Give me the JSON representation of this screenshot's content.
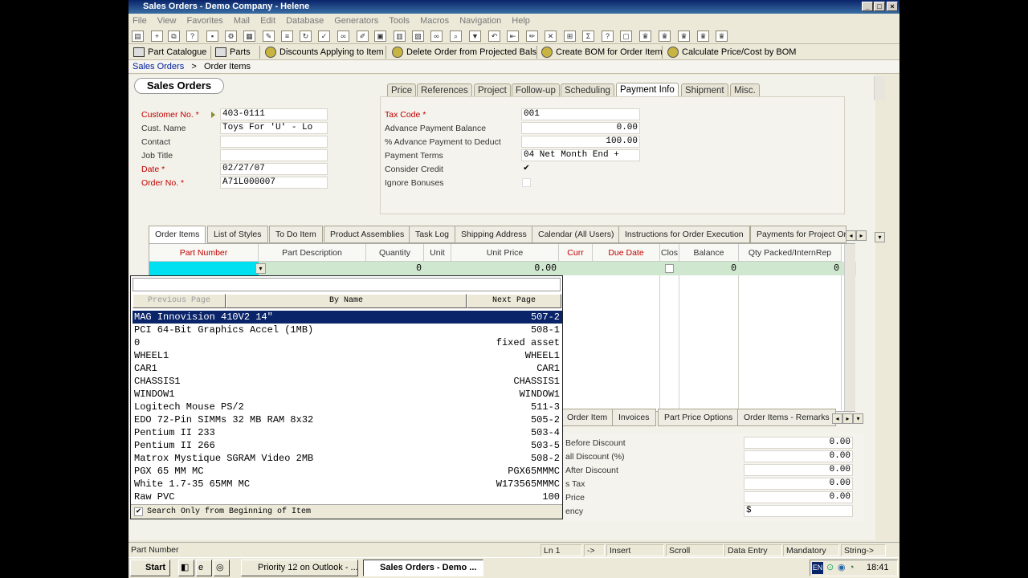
{
  "window": {
    "title": "Sales Orders - Demo Company - Helene"
  },
  "menu": [
    "File",
    "View",
    "Favorites",
    "Mail",
    "Edit",
    "Database",
    "Generators",
    "Tools",
    "Macros",
    "Navigation",
    "Help"
  ],
  "toolbar2": {
    "part_catalogue": "Part Catalogue",
    "parts": "Parts",
    "discounts": "Discounts Applying to Item",
    "delete_order": "Delete Order from Projected Bals",
    "create_bom": "Create BOM for Order Item",
    "calc_price": "Calculate Price/Cost by BOM"
  },
  "breadcrumb": {
    "root": "Sales Orders",
    "sep": ">",
    "current": "Order Items"
  },
  "form": {
    "title": "Sales Orders",
    "customer_no_label": "Customer No. *",
    "customer_no": "403-0111",
    "cust_name_label": "Cust. Name",
    "cust_name": "Toys For 'U' - Lo",
    "contact_label": "Contact",
    "contact": "",
    "job_title_label": "Job Title",
    "job_title": "",
    "date_label": "Date *",
    "date": "02/27/07",
    "order_no_label": "Order No. *",
    "order_no": "A71L000007"
  },
  "top_tabs": [
    "Price",
    "References",
    "Project",
    "Follow-up",
    "Scheduling",
    "Payment Info",
    "Shipment",
    "Misc."
  ],
  "payment": {
    "tax_code_label": "Tax Code *",
    "tax_code": "001",
    "adv_balance_label": "Advance Payment Balance",
    "adv_balance": "0.00",
    "adv_pct_label": "% Advance Payment to Deduct",
    "adv_pct": "100.00",
    "terms_label": "Payment Terms",
    "terms": "04  Net Month End +",
    "consider_credit_label": "Consider Credit",
    "ignore_bonuses_label": "Ignore Bonuses"
  },
  "grid_tabs": [
    "Order Items",
    "List of Styles",
    "To Do Item",
    "Product Assemblies",
    "Task Log",
    "Shipping Address",
    "Calendar (All Users)",
    "Instructions for Order Execution",
    "Payments for Project Or"
  ],
  "grid": {
    "headers": [
      "Part Number",
      "Part Description",
      "Quantity",
      "Unit",
      "Unit Price",
      "Curr",
      "Due Date",
      "Clos",
      "Balance",
      "Qty Packed/InternRep"
    ],
    "row": {
      "quantity": "0",
      "unit_price": "0.00",
      "balance": "0",
      "qty_packed": "0"
    }
  },
  "bottom_tabs": [
    "Order Item",
    "Invoices",
    "Part Price Options",
    "Order Items - Remarks"
  ],
  "totals": {
    "labels": [
      "Before Discount",
      "all Discount (%)",
      "After Discount",
      "s Tax",
      "Price",
      "ency"
    ],
    "values": [
      "0.00",
      "0.00",
      "0.00",
      "0.00",
      "0.00",
      "$"
    ]
  },
  "popup": {
    "prev": "Previous Page",
    "by_name": "By Name",
    "next": "Next Page",
    "items": [
      {
        "name": "MAG Innovision 410V2 14\"",
        "code": "507-2"
      },
      {
        "name": "PCI 64-Bit Graphics Accel (1MB)",
        "code": "508-1"
      },
      {
        "name": "0",
        "code": "fixed asset"
      },
      {
        "name": "WHEEL1",
        "code": "WHEEL1"
      },
      {
        "name": "CAR1",
        "code": "CAR1"
      },
      {
        "name": "CHASSIS1",
        "code": "CHASSIS1"
      },
      {
        "name": "WINDOW1",
        "code": "WINDOW1"
      },
      {
        "name": "Logitech Mouse PS/2",
        "code": "511-3"
      },
      {
        "name": "EDO 72-Pin SIMMs 32 MB RAM 8x32",
        "code": "505-2"
      },
      {
        "name": "Pentium II 233",
        "code": "503-4"
      },
      {
        "name": "Pentium II 266",
        "code": "503-5"
      },
      {
        "name": "Matrox Mystique SGRAM Video 2MB",
        "code": "508-2"
      },
      {
        "name": "PGX 65 MM MC",
        "code": "PGX65MMMC"
      },
      {
        "name": "White 1.7-35 65MM MC",
        "code": "W173565MMMC"
      },
      {
        "name": "Raw PVC",
        "code": "100"
      }
    ],
    "footer": "Search Only from Beginning of Item"
  },
  "status": [
    "Part Number",
    "Ln 1",
    "->",
    "Insert",
    "Scroll",
    "Data Entry",
    "Mandatory",
    "String->"
  ],
  "taskbar": {
    "start": "Start",
    "task1": "Priority 12 on Outlook - ...",
    "task2": "Sales Orders - Demo ...",
    "lang": "EN",
    "clock": "18:41"
  }
}
